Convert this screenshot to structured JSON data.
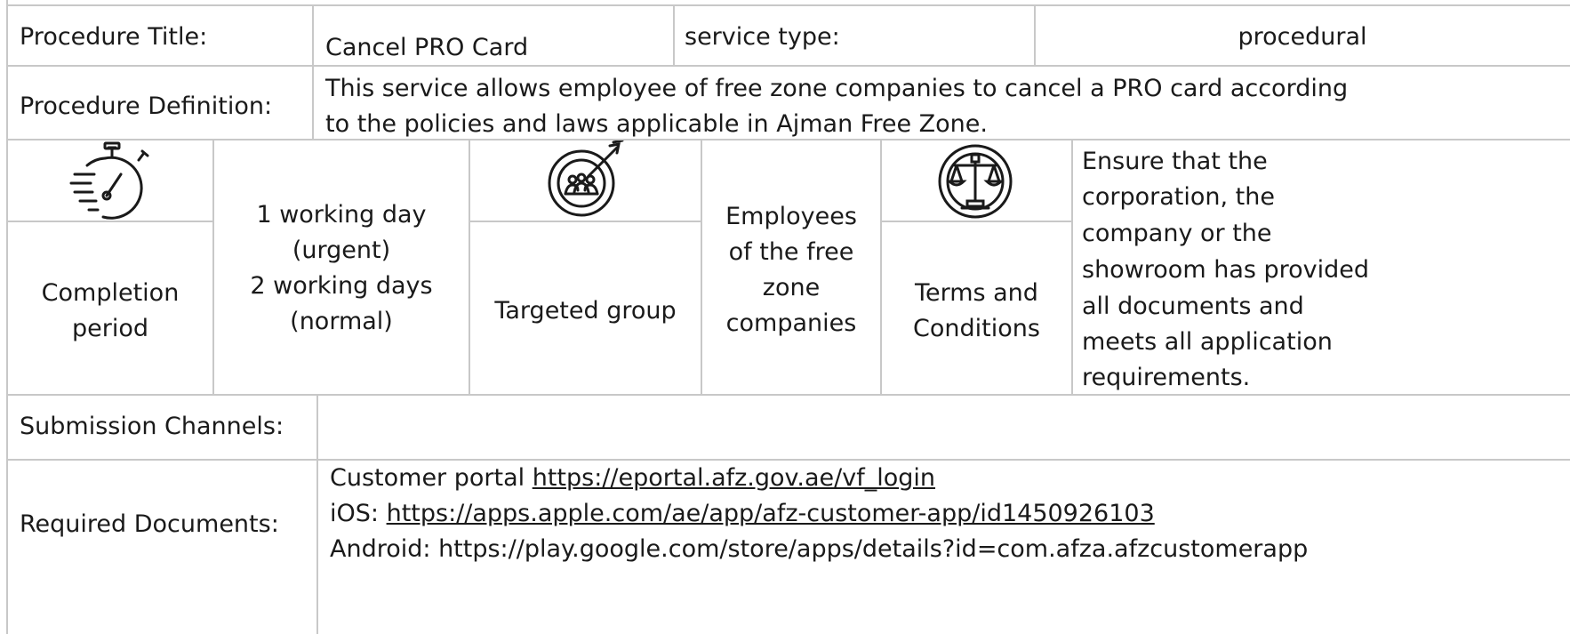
{
  "header_row": {
    "procedure_title_label": "Procedure Title:",
    "procedure_title_value": "Cancel PRO Card",
    "service_type_label": "service type:",
    "service_type_value": "procedural"
  },
  "definition_row": {
    "label": "Procedure Definition:",
    "line1": "This service allows employee of free zone companies to cancel a PRO card according",
    "line2": "to the policies and laws applicable in Ajman Free Zone."
  },
  "info_row": {
    "icons": [
      "stopwatch-icon",
      "target-group-icon",
      "scales-icon"
    ],
    "completion": {
      "label_line1": "Completion",
      "label_line2": "period",
      "value_lines": [
        "1 working day",
        "(urgent)",
        "2 working days",
        "(normal)"
      ]
    },
    "targeted": {
      "label": "Targeted group",
      "value_lines": [
        "Employees",
        "of the free",
        "zone",
        "companies"
      ]
    },
    "terms": {
      "label_line1": "Terms and",
      "label_line2": "Conditions",
      "value_lines": [
        "Ensure that the",
        "corporation, the",
        "company or the",
        "showroom has provided",
        "all documents and",
        "meets all application",
        "requirements."
      ]
    }
  },
  "submission_row": {
    "label": "Submission Channels:"
  },
  "documents_row": {
    "label": "Required Documents:",
    "portal_prefix": "Customer portal ",
    "portal_url": "https://eportal.afz.gov.ae/vf_login",
    "ios_prefix": "iOS: ",
    "ios_url": "https://apps.apple.com/ae/app/afz-customer-app/id1450926103",
    "android_text": "Android: https://play.google.com/store/apps/details?id=com.afza.afzcustomerapp"
  }
}
